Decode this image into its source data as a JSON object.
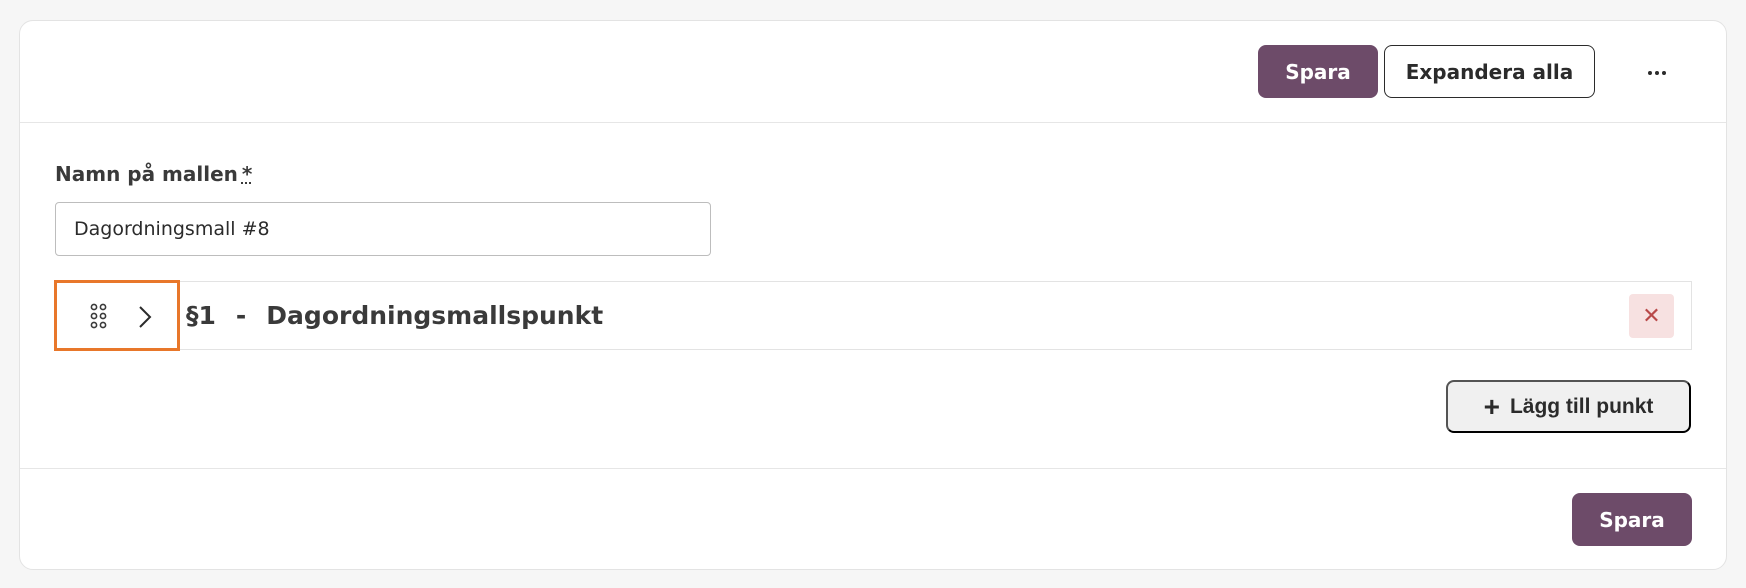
{
  "header": {
    "save_label": "Spara",
    "expand_label": "Expandera alla",
    "more_icon": "more-horizontal-icon"
  },
  "form": {
    "name_label": "Namn på mallen",
    "required_marker": "*",
    "name_value": "Dagordningsmall #8"
  },
  "agenda_items": [
    {
      "number": "§1",
      "separator": "-",
      "title": "Dagordningsmallspunkt"
    }
  ],
  "actions": {
    "add_point_label": "Lägg till punkt",
    "footer_save_label": "Spara"
  },
  "colors": {
    "primary": "#6d4b69",
    "highlight": "#e8772a",
    "delete_bg": "#f7e1e1",
    "delete_fg": "#b84848"
  }
}
